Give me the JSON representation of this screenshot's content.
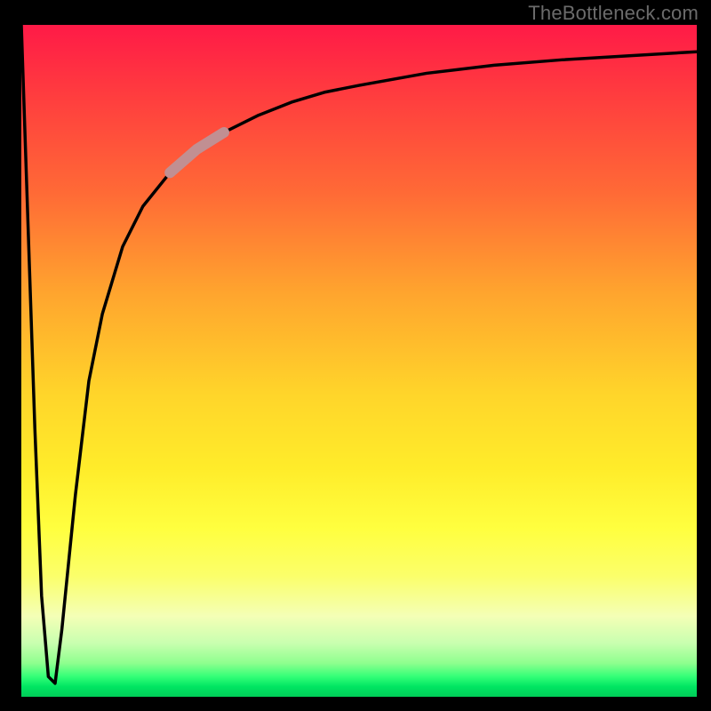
{
  "attribution": "TheBottleneck.com",
  "colors": {
    "background": "#000000",
    "curve_stroke": "#000000",
    "highlight_segment": "#c18f92",
    "gradient_stops": [
      "#ff1a47",
      "#ff3b3f",
      "#ff6a36",
      "#ffa52e",
      "#ffd52a",
      "#ffec2a",
      "#ffff3f",
      "#fbff6a",
      "#f4ffb6",
      "#c9ffb0",
      "#8eff8e",
      "#33ff77",
      "#00e562",
      "#00cc58"
    ]
  },
  "chart_data": {
    "type": "line",
    "title": "",
    "xlabel": "",
    "ylabel": "",
    "xlim": [
      0,
      100
    ],
    "ylim": [
      0,
      100
    ],
    "grid": false,
    "series": [
      {
        "name": "primary-curve",
        "x": [
          0,
          1,
          2,
          3,
          4,
          5,
          6,
          8,
          10,
          12,
          15,
          18,
          22,
          26,
          30,
          35,
          40,
          45,
          50,
          60,
          70,
          80,
          90,
          100
        ],
        "y": [
          100,
          70,
          40,
          15,
          3,
          2,
          10,
          30,
          47,
          57,
          67,
          73,
          78,
          81.5,
          84,
          86.5,
          88.5,
          90,
          91,
          92.8,
          94,
          94.8,
          95.4,
          96
        ]
      }
    ],
    "highlight_segment": {
      "series": "primary-curve",
      "x_start": 22,
      "x_end": 30
    }
  }
}
